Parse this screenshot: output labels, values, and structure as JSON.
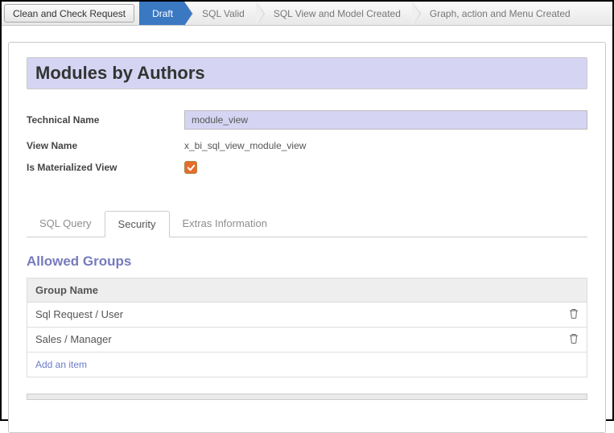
{
  "topbar": {
    "clean_button": "Clean and Check Request",
    "steps": [
      "Draft",
      "SQL Valid",
      "SQL View and Model Created",
      "Graph, action and Menu Created"
    ],
    "active_index": 0
  },
  "form": {
    "title": "Modules by Authors",
    "labels": {
      "technical_name": "Technical Name",
      "view_name": "View Name",
      "is_materialized": "Is Materialized View"
    },
    "values": {
      "technical_name": "module_view",
      "view_name": "x_bi_sql_view_module_view",
      "is_materialized": true
    }
  },
  "tabs": [
    "SQL Query",
    "Security",
    "Extras Information"
  ],
  "active_tab_index": 1,
  "security": {
    "section_title": "Allowed Groups",
    "column_header": "Group Name",
    "rows": [
      "Sql Request / User",
      "Sales / Manager"
    ],
    "add_item_label": "Add an item"
  }
}
